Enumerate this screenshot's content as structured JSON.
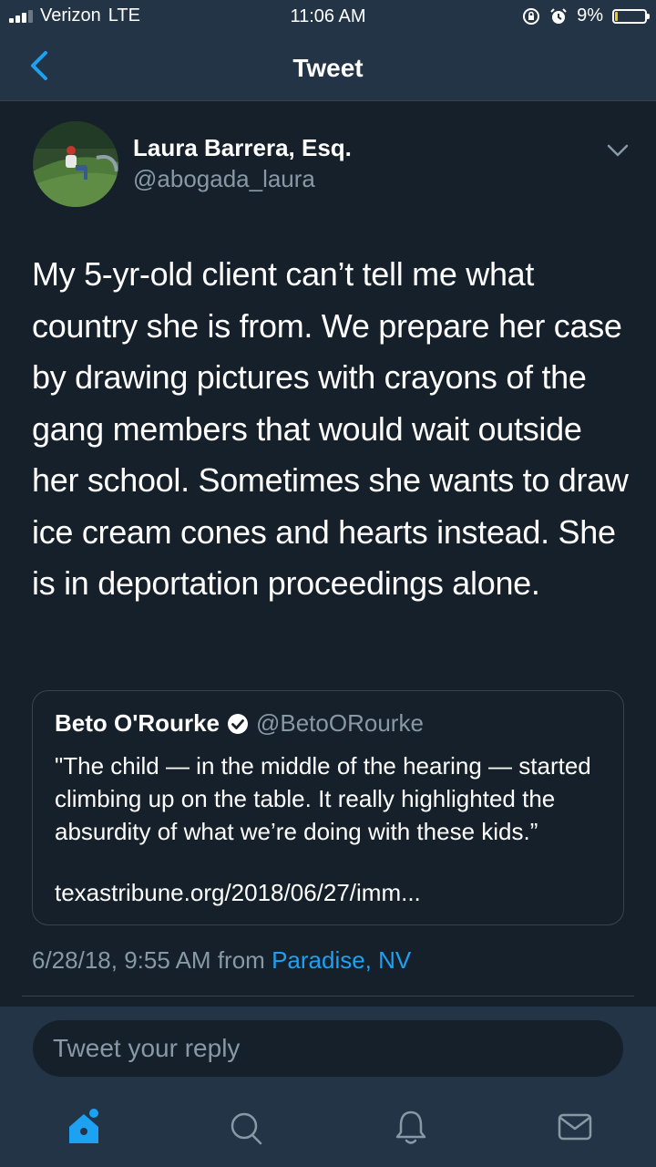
{
  "status_bar": {
    "carrier": "Verizon",
    "network": "LTE",
    "time": "11:06 AM",
    "battery_text": "9%",
    "battery_level": 0.09
  },
  "nav": {
    "title": "Tweet",
    "back_icon": "chevron-left-icon"
  },
  "tweet": {
    "author_name": "Laura Barrera, Esq.",
    "author_handle": "@abogada_laura",
    "text": "My 5-yr-old client can’t tell me what country she is from. We prepare her case by drawing pictures with crayons of the gang members that would wait outside her school.  Sometimes she wants to draw ice cream cones and hearts instead.  She is in deportation proceedings alone.",
    "timestamp": "6/28/18, 9:55 AM",
    "from_label": "from",
    "location": "Paradise, NV"
  },
  "quoted": {
    "name": "Beto O'Rourke",
    "handle": "@BetoORourke",
    "text": "\"The child — in the middle of the hearing — started climbing up on the table. It really highlighted the absurdity of what we’re doing with these kids.”",
    "url": "texastribune.org/2018/06/27/imm..."
  },
  "reply": {
    "placeholder": "Tweet your reply"
  },
  "tabs": [
    "home-icon",
    "search-icon",
    "notifications-icon",
    "messages-icon"
  ],
  "colors": {
    "background": "#15202b",
    "bar": "#243447",
    "accent": "#1da1f2",
    "muted": "#8899a6",
    "border": "#38444d"
  }
}
